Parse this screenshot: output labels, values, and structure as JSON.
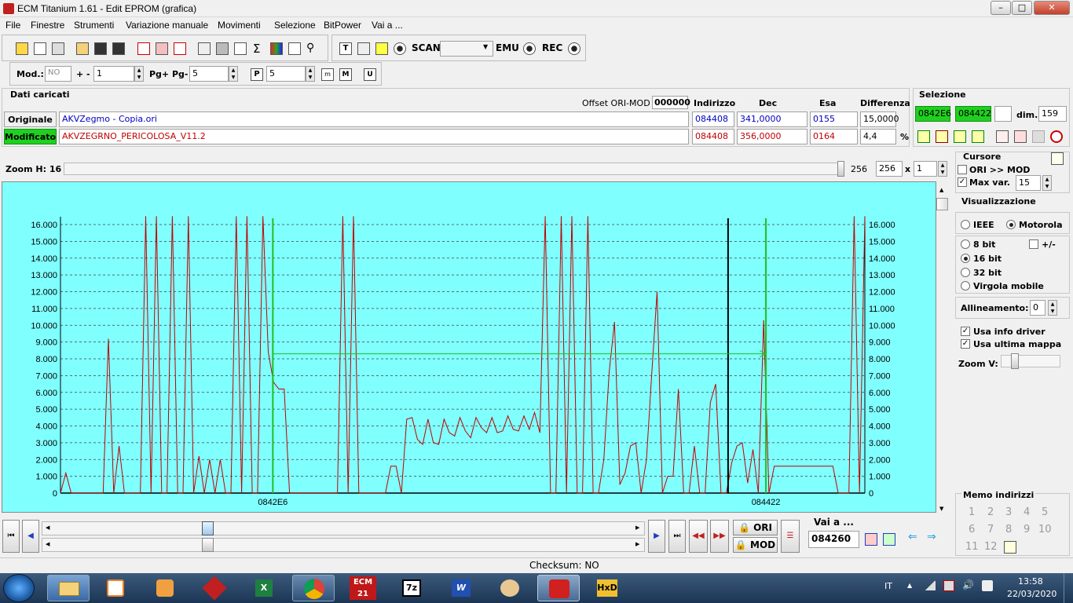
{
  "window": {
    "title": "ECM Titanium 1.61 - Edit EPROM (grafica)",
    "min": "–",
    "max": "□",
    "close": "✕"
  },
  "menu": [
    "File",
    "Finestre",
    "Strumenti",
    "Variazione manuale",
    "Movimenti",
    "Selezione",
    "BitPower",
    "Vai a ..."
  ],
  "toolbar": {
    "scan_label": "SCAN",
    "emu_label": "EMU",
    "rec_label": "REC"
  },
  "toolbar2": {
    "mod_label": "Mod.:",
    "mod_value": "NO",
    "plusminus_label": "+ -",
    "plusminus_value": "1",
    "pg_label": "Pg+ Pg-",
    "pg_value": "5",
    "p_value": "5"
  },
  "dati": {
    "title": "Dati caricati",
    "offset_label": "Offset ORI-MOD",
    "offset_value": "000000",
    "col_indirizzo": "Indirizzo",
    "col_dec": "Dec",
    "col_esa": "Esa",
    "col_diff": "Differenza",
    "originale": {
      "label": "Originale",
      "file": "AKVZegmo - Copia.ori",
      "indirizzo": "084408",
      "dec": "341,0000",
      "esa": "0155",
      "diff": "15,0000"
    },
    "modificato": {
      "label": "Modificato",
      "file": "AKVZEGRNO_PERICOLOSA_V11.2",
      "indirizzo": "084408",
      "dec": "356,0000",
      "esa": "0164",
      "diff": "4,4",
      "unit": "%"
    }
  },
  "selezione": {
    "title": "Selezione",
    "start": "0842E6",
    "end": "084422",
    "dim_label": "dim.",
    "dim_value": "159"
  },
  "zoom": {
    "label": "Zoom H: 16",
    "value1": "256",
    "value2": "256",
    "x": "x",
    "mult": "1"
  },
  "chart_data": {
    "type": "line",
    "y_ticks": [
      "0",
      "1.000",
      "2.000",
      "3.000",
      "4.000",
      "5.000",
      "6.000",
      "7.000",
      "8.000",
      "9.000",
      "10.000",
      "11.000",
      "12.000",
      "13.000",
      "14.000",
      "15.000",
      "16.000"
    ],
    "ylim": [
      0,
      16000
    ],
    "x_labels": [
      "0842E6",
      "084422"
    ],
    "series": [
      {
        "values": [
          0,
          1200,
          0,
          0,
          0,
          0,
          0,
          0,
          0,
          9200,
          0,
          2800,
          0,
          0,
          0,
          0,
          16500,
          0,
          16500,
          0,
          0,
          16500,
          0,
          0,
          16500,
          0,
          2200,
          0,
          2000,
          0,
          2000,
          0,
          0,
          16500,
          0,
          16500,
          0,
          0,
          16500,
          8400,
          6600,
          6200,
          6200,
          0,
          0,
          0,
          0,
          0,
          0,
          0,
          0,
          0,
          0,
          16500,
          0,
          16500,
          0,
          0,
          0,
          0,
          0,
          0,
          1600,
          1600,
          0,
          4400,
          4500,
          3200,
          2900,
          4400,
          3000,
          2900,
          4400,
          3600,
          3400,
          4500,
          3700,
          3300,
          4500,
          3900,
          3600,
          4500,
          3600,
          3700,
          4600,
          3800,
          3700,
          4600,
          3800,
          4800,
          3600,
          16500,
          0,
          0,
          16500,
          0,
          16500,
          0,
          0,
          16500,
          0,
          0,
          2000,
          7200,
          10200,
          500,
          1200,
          2800,
          3000,
          0,
          2000,
          7100,
          12000,
          0,
          1000,
          1000,
          6200,
          0,
          0,
          2800,
          0,
          0,
          5400,
          6500,
          0,
          0,
          1800,
          2800,
          3000,
          600,
          2600,
          0,
          10300,
          0,
          1600,
          1600,
          1600,
          1600,
          1600,
          1600,
          1600,
          1600,
          1600,
          1600,
          1600,
          1600,
          0,
          0,
          0,
          16500,
          0,
          16500
        ]
      }
    ],
    "cursor_labels": [
      "0842E6",
      "084422"
    ]
  },
  "cursore": {
    "title": "Cursore",
    "ori_mod": "ORI >> MOD",
    "max_var": "Max var.",
    "max_var_value": "15"
  },
  "vis": {
    "title": "Visualizzazione",
    "ieee": "IEEE",
    "motorola": "Motorola",
    "b8": "8 bit",
    "pm": "+/-",
    "b16": "16 bit",
    "b32": "32 bit",
    "virgola": "Virgola mobile",
    "allin_label": "Allineamento:",
    "allin_value": "0",
    "usa_info": "Usa info driver",
    "usa_ultima": "Usa ultima mappa",
    "zoomv": "Zoom V:"
  },
  "bottom": {
    "ori": "ORI",
    "mod": "MOD",
    "vai_label": "Vai a ...",
    "vai_value": "084260",
    "checksum": "Checksum: NO"
  },
  "memo": {
    "title": "Memo indirizzi",
    "items": [
      "1",
      "2",
      "3",
      "4",
      "5",
      "6",
      "7",
      "8",
      "9",
      "10",
      "11",
      "12"
    ]
  },
  "tray": {
    "lang": "IT",
    "time": "13:58",
    "date": "22/03/2020"
  }
}
